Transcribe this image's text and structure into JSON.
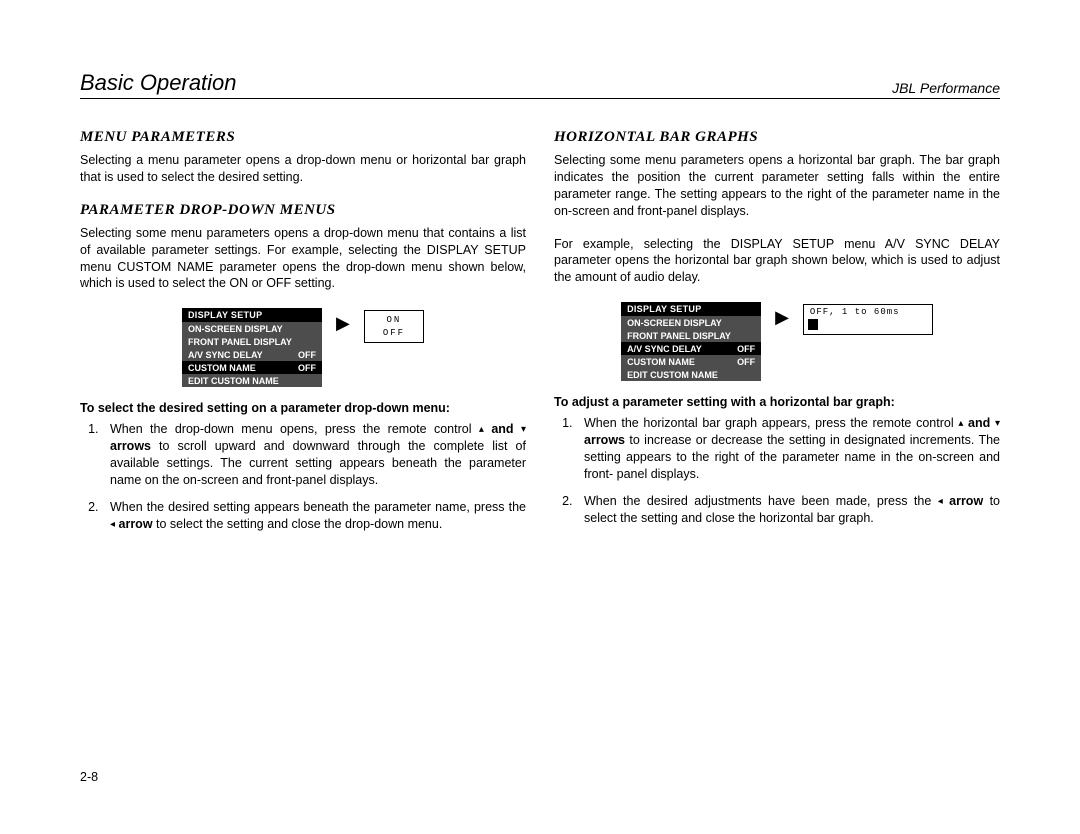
{
  "header": {
    "left": "Basic Operation",
    "right": "JBL Performance"
  },
  "left_col": {
    "h1": "Menu Parameters",
    "p1": "Selecting a menu parameter opens a drop-down menu or horizontal bar graph that is used to select the desired setting.",
    "h2": "Parameter Drop-Down Menus",
    "p2": "Selecting some menu parameters opens a drop-down menu that contains a list of available parameter settings. For example, selecting the DISPLAY SETUP menu CUSTOM NAME parameter opens the drop-down menu shown below, which is used to select the ON or OFF setting.",
    "fig": {
      "menu_title": "DISPLAY SETUP",
      "rows": [
        {
          "label": "ON-SCREEN DISPLAY",
          "val": ""
        },
        {
          "label": "FRONT PANEL DISPLAY",
          "val": ""
        },
        {
          "label": "A/V SYNC DELAY",
          "val": "OFF"
        },
        {
          "label": "CUSTOM NAME",
          "val": "OFF",
          "hl": true
        },
        {
          "label": "EDIT CUSTOM NAME",
          "val": ""
        }
      ],
      "dropdown_opt1": "ON",
      "dropdown_opt2": "OFF"
    },
    "bold1": "To select the desired setting on a parameter drop-down menu:",
    "step1a": "When the drop-down menu opens, press the remote control ",
    "step1b": " and ",
    "step1c": " arrows",
    "step1d": " to scroll upward and downward through the complete list of available settings. The current setting appears beneath the parameter name on the on-screen and front-panel displays.",
    "step2a": "When the desired setting appears beneath the parameter name, press the ",
    "step2b": " arrow",
    "step2c": " to select the setting and close the drop-down menu."
  },
  "right_col": {
    "h1": "Horizontal Bar Graphs",
    "p1": "Selecting some menu parameters opens a horizontal bar graph. The bar graph indicates the position the current parameter setting falls within the entire parameter range. The setting appears to the right of the parameter name in the on-screen and front-panel displays.",
    "p2": "For example, selecting the DISPLAY SETUP menu A/V SYNC DELAY parameter opens the horizontal bar graph shown below, which is used to adjust the amount of audio delay.",
    "fig": {
      "menu_title": "DISPLAY SETUP",
      "rows": [
        {
          "label": "ON-SCREEN DISPLAY",
          "val": ""
        },
        {
          "label": "FRONT PANEL DISPLAY",
          "val": ""
        },
        {
          "label": "A/V SYNC DELAY",
          "val": "OFF",
          "hl": true
        },
        {
          "label": "CUSTOM NAME",
          "val": "OFF"
        },
        {
          "label": "EDIT CUSTOM NAME",
          "val": ""
        }
      ],
      "bar_label": "OFF, 1 to 60ms"
    },
    "bold1": "To adjust a parameter setting with a horizontal bar graph:",
    "step1a": "When the horizontal bar graph appears, press the remote control ",
    "step1b": " and ",
    "step1c": " arrows",
    "step1d": " to increase or decrease the setting in designated increments. The setting appears to the right of the parameter name in the on-screen and front- panel displays.",
    "step2a": "When the desired adjustments have been made, press the ",
    "step2b": " arrow",
    "step2c": " to select the setting and close the horizontal bar graph."
  },
  "footer": "2-8"
}
